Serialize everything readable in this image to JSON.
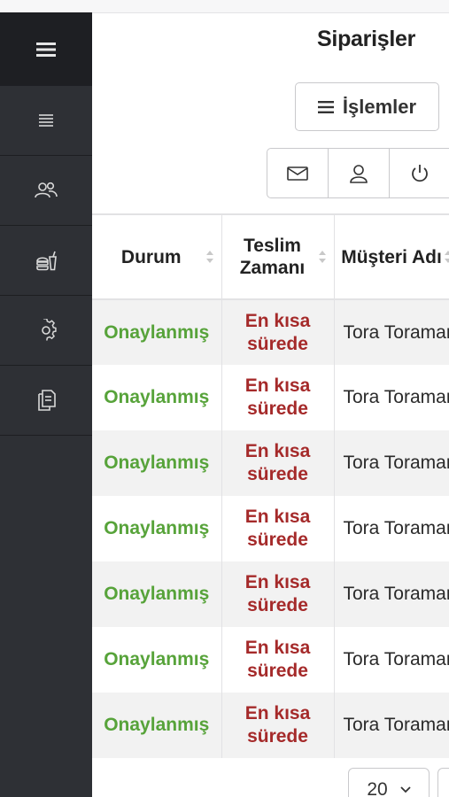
{
  "page": {
    "title": "Siparişler"
  },
  "sidebar": {
    "toggle_icon": "hamburger-icon",
    "items": [
      {
        "icon": "list-icon"
      },
      {
        "icon": "users-icon"
      },
      {
        "icon": "food-icon"
      },
      {
        "icon": "gear-icon"
      },
      {
        "icon": "documents-icon"
      }
    ]
  },
  "toolbar": {
    "actions_label": "İşlemler",
    "icons": [
      "mail-icon",
      "user-icon",
      "power-icon"
    ]
  },
  "table": {
    "columns": [
      {
        "label": "Durum"
      },
      {
        "label": "Teslim Zamanı"
      },
      {
        "label": "Müşteri Adı"
      }
    ],
    "rows": [
      {
        "status": "Onaylanmış",
        "delivery": "En kısa süredе",
        "customer": "Tora Toraman"
      },
      {
        "status": "Onaylanmış",
        "delivery": "En kısa süredе",
        "customer": "Tora Toraman"
      },
      {
        "status": "Onaylanmış",
        "delivery": "En kısa süredе",
        "customer": "Tora Toraman"
      },
      {
        "status": "Onaylanmış",
        "delivery": "En kısa süredе",
        "customer": "Tora Toraman"
      },
      {
        "status": "Onaylanmış",
        "delivery": "En kısa süredе",
        "customer": "Tora Toraman"
      },
      {
        "status": "Onaylanmış",
        "delivery": "En kısa süredе",
        "customer": "Tora Toraman"
      },
      {
        "status": "Onaylanmış",
        "delivery": "En kısa süredе",
        "customer": "Tora Toraman"
      }
    ]
  },
  "pagination": {
    "page_size": "20"
  },
  "colors": {
    "status": "#57a33a",
    "delivery": "#a52a2a",
    "sidebar": "#2e3035"
  }
}
